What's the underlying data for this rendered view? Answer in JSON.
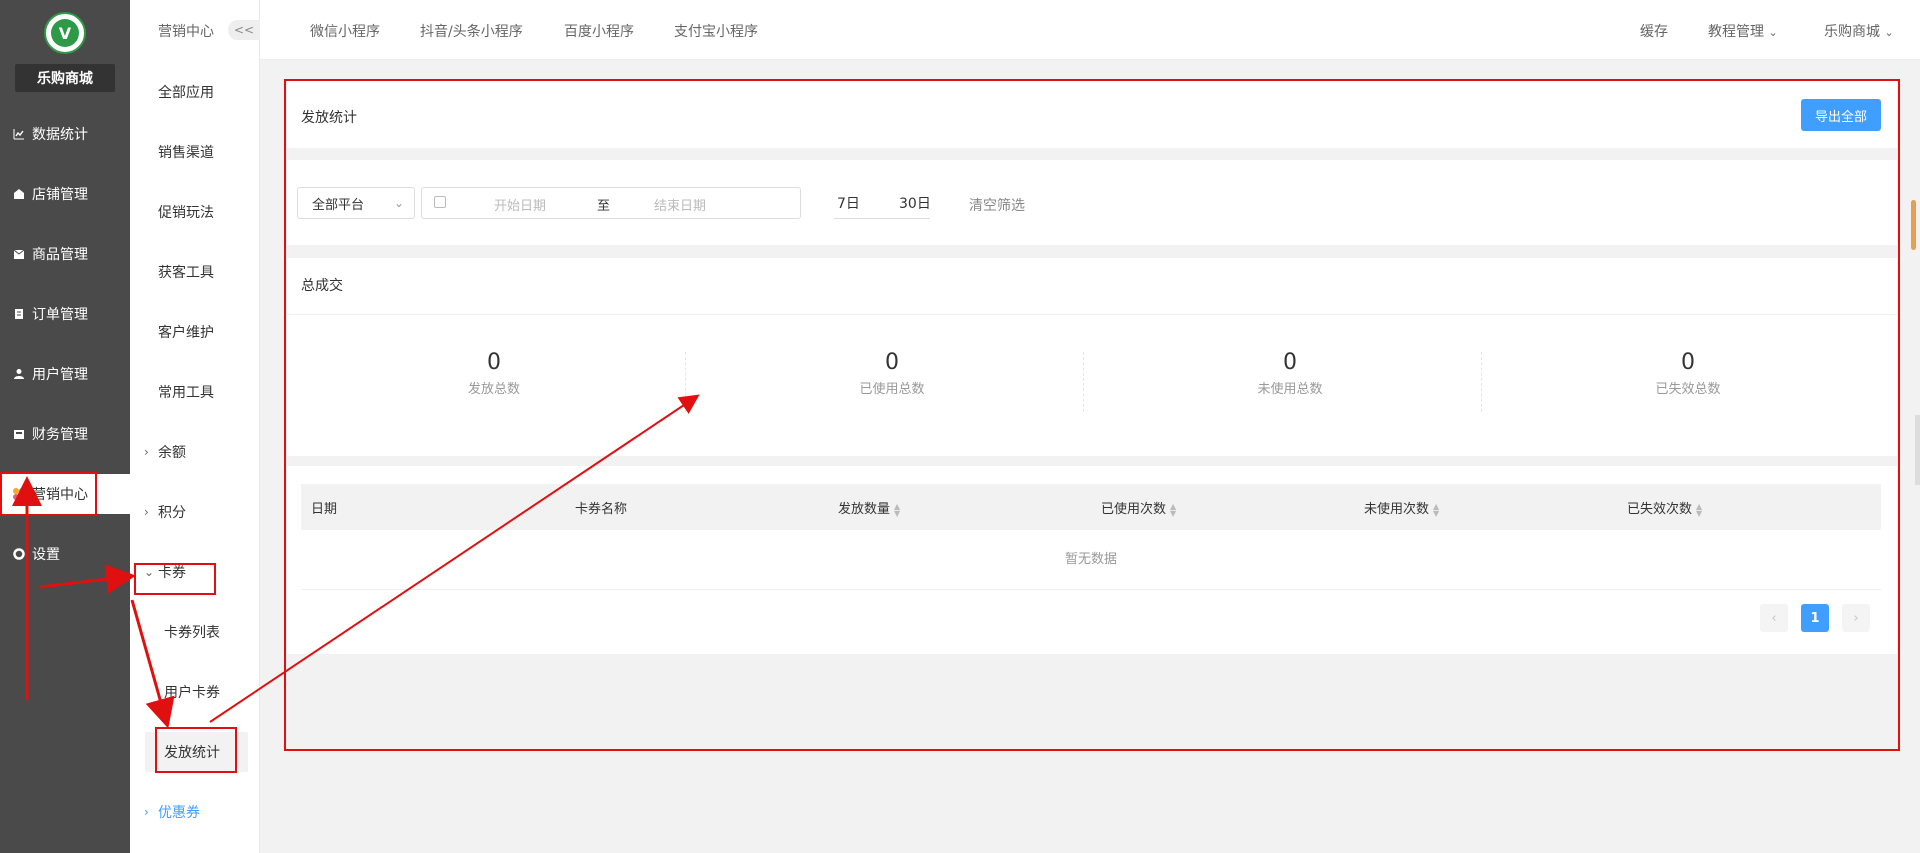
{
  "brand": {
    "name": "乐购商城",
    "logo_glyph": "V"
  },
  "sidebar": {
    "items": [
      {
        "label": "数据统计",
        "icon": "line-chart-icon"
      },
      {
        "label": "店铺管理",
        "icon": "store-icon"
      },
      {
        "label": "商品管理",
        "icon": "box-icon"
      },
      {
        "label": "订单管理",
        "icon": "clipboard-icon"
      },
      {
        "label": "用户管理",
        "icon": "user-icon"
      },
      {
        "label": "财务管理",
        "icon": "wallet-icon"
      },
      {
        "label": "营销中心",
        "icon": "marketing-icon"
      },
      {
        "label": "设置",
        "icon": "gear-icon"
      }
    ]
  },
  "subnav": {
    "title": "营销中心",
    "collapse": "<<",
    "items": [
      {
        "label": "全部应用"
      },
      {
        "label": "销售渠道"
      },
      {
        "label": "促销玩法"
      },
      {
        "label": "获客工具"
      },
      {
        "label": "客户维护"
      },
      {
        "label": "常用工具"
      },
      {
        "label": "余额"
      },
      {
        "label": "积分"
      },
      {
        "label": "卡券"
      },
      {
        "label": "卡券列表"
      },
      {
        "label": "用户卡券"
      },
      {
        "label": "发放统计"
      },
      {
        "label": "优惠券"
      }
    ]
  },
  "topbar": {
    "tabs": [
      "微信小程序",
      "抖音/头条小程序",
      "百度小程序",
      "支付宝小程序"
    ],
    "right": {
      "cache": "缓存",
      "tutorial": "教程管理",
      "store": "乐购商城"
    }
  },
  "page": {
    "title": "发放统计",
    "export_label": "导出全部",
    "filters": {
      "platform": "全部平台",
      "start_placeholder": "开始日期",
      "to": "至",
      "end_placeholder": "结束日期",
      "d7": "7日",
      "d30": "30日",
      "clear": "清空筛选"
    },
    "summary": {
      "title": "总成交",
      "stats": [
        {
          "value": "0",
          "label": "发放总数"
        },
        {
          "value": "0",
          "label": "已使用总数"
        },
        {
          "value": "0",
          "label": "未使用总数"
        },
        {
          "value": "0",
          "label": "已失效总数"
        }
      ]
    },
    "table": {
      "columns": [
        "日期",
        "卡券名称",
        "发放数量",
        "已使用次数",
        "未使用次数",
        "已失效次数"
      ],
      "empty": "暂无数据"
    },
    "pagination": {
      "current": "1",
      "prev": "‹",
      "next": "›"
    }
  },
  "colors": {
    "primary": "#409eff",
    "sidebar": "#4a4a4a",
    "annotation": "#e01010"
  }
}
